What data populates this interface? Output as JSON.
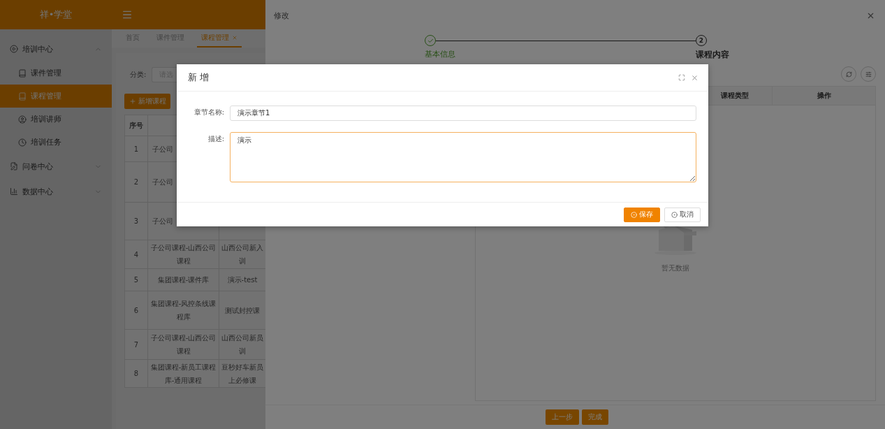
{
  "app": {
    "logo": "祥•学堂"
  },
  "sidebar": {
    "groups": [
      {
        "label": "培训中心",
        "expanded": true,
        "items": [
          {
            "label": "课件管理",
            "selected": false
          },
          {
            "label": "课程管理",
            "selected": true
          },
          {
            "label": "培训讲师",
            "selected": false
          },
          {
            "label": "培训任务",
            "selected": false
          }
        ]
      },
      {
        "label": "问卷中心",
        "expanded": false
      },
      {
        "label": "数据中心",
        "expanded": false
      }
    ]
  },
  "tabs": [
    {
      "label": "首页",
      "selected": false
    },
    {
      "label": "课件管理",
      "selected": false
    },
    {
      "label": "课程管理",
      "selected": true
    }
  ],
  "filter": {
    "label": "分类:",
    "placeholder": "请选"
  },
  "add_button": "新增课程",
  "table": {
    "columns": [
      "序号"
    ],
    "rows": [
      {
        "index": "1",
        "column_2": "子公司"
      },
      {
        "index": "2",
        "column_2": "子公司"
      },
      {
        "index": "3",
        "column_2": "子公司"
      },
      {
        "index": "4",
        "column_2": "子公司课程-山西公司课程",
        "column_3": [
          "山西公司新入",
          "训"
        ]
      },
      {
        "index": "5",
        "column_2": "集团课程-课件库",
        "column_3": [
          "演示-test"
        ]
      },
      {
        "index": "6",
        "column_2": "集团课程-风控条线课程库",
        "column_3": [
          "测试封控课"
        ]
      },
      {
        "index": "7",
        "column_2": "子公司课程-山西公司课程",
        "column_3": [
          "山西公司新员",
          "训"
        ]
      },
      {
        "index": "8",
        "column_2": "集团课程-新员工课程库-通用课程",
        "column_3": [
          "豆秒好车新员",
          "上必修课"
        ]
      }
    ]
  },
  "drawer": {
    "title": "修改",
    "steps": [
      {
        "label": "基本信息",
        "done": true
      },
      {
        "label": "课程内容",
        "number": "2",
        "done": false
      }
    ],
    "columns": [
      "课程类型",
      "操作"
    ],
    "empty_text": "暂无数据",
    "buttons": [
      "上一步",
      "完成"
    ]
  },
  "modal": {
    "title": "新 增",
    "fields": [
      {
        "kind": "input",
        "label": "章节名称:",
        "value": "演示章节1",
        "focused": false
      },
      {
        "kind": "textarea",
        "label": "描述:",
        "value": "演示",
        "focused": true
      }
    ],
    "buttons": [
      {
        "label": "保存",
        "kind": "primary"
      },
      {
        "label": "取消",
        "kind": "default"
      }
    ]
  }
}
